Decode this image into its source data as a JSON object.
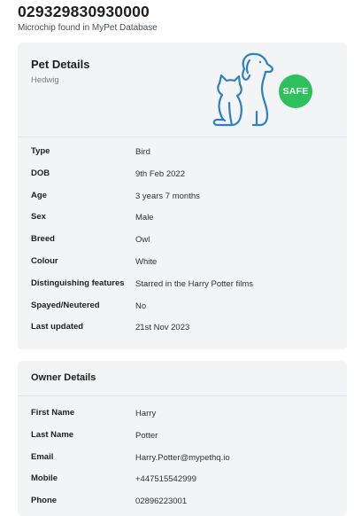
{
  "header": {
    "microchip_number": "029329830930000",
    "status_text": "Microchip found in MyPet Database"
  },
  "pet_details": {
    "title": "Pet Details",
    "pet_name": "Hedwig",
    "safe_badge": "SAFE",
    "safe_color": "#2fbf5c",
    "illustration_icon": "dog-and-cat-icon",
    "rows": [
      {
        "label": "Type",
        "value": "Bird"
      },
      {
        "label": "DOB",
        "value": "9th Feb 2022"
      },
      {
        "label": "Age",
        "value": "3 years 7 months"
      },
      {
        "label": "Sex",
        "value": "Male"
      },
      {
        "label": "Breed",
        "value": "Owl"
      },
      {
        "label": "Colour",
        "value": "White"
      },
      {
        "label": "Distinguishing features",
        "value": "Starred in the Harry Potter films"
      },
      {
        "label": "Spayed/Neutered",
        "value": "No"
      },
      {
        "label": "Last updated",
        "value": "21st Nov 2023"
      }
    ]
  },
  "owner_details": {
    "title": "Owner Details",
    "rows": [
      {
        "label": "First Name",
        "value": "Harry"
      },
      {
        "label": "Last Name",
        "value": "Potter"
      },
      {
        "label": "Email",
        "value": "Harry.Potter@mypethq.io"
      },
      {
        "label": "Mobile",
        "value": "+447515542999"
      },
      {
        "label": "Phone",
        "value": "02896223001"
      }
    ]
  },
  "colors": {
    "card_background": "#f3f4f6",
    "illustration_stroke": "#2e7fc1"
  }
}
